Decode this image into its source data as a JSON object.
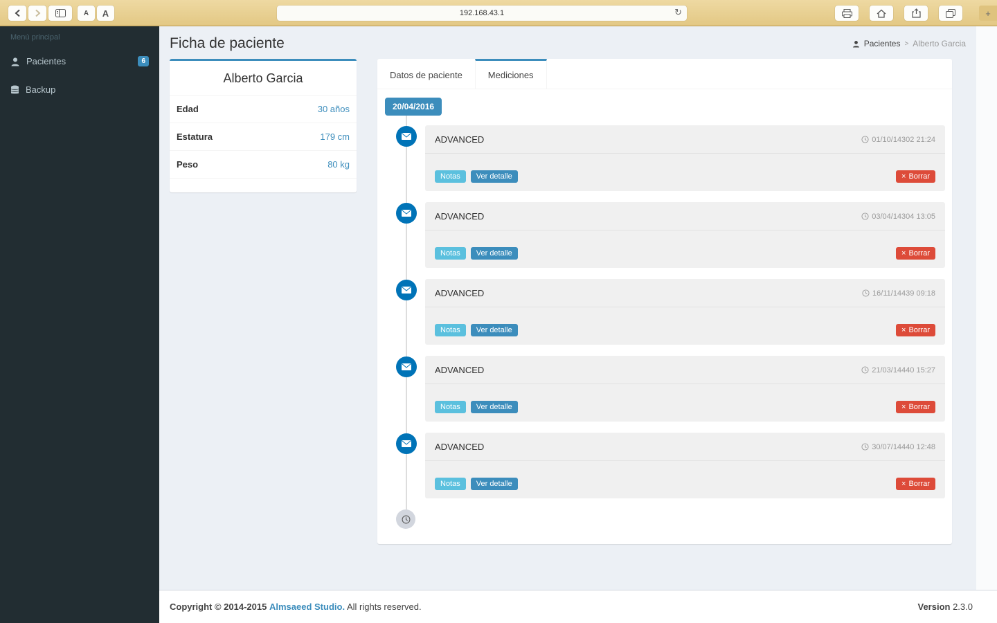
{
  "browser": {
    "url": "192.168.43.1",
    "font_small_label": "A",
    "font_large_label": "A",
    "reload_icon": "↻",
    "new_tab_icon": "+"
  },
  "sidebar": {
    "menu_header": "Menú principal",
    "items": [
      {
        "label": "Pacientes",
        "badge": "6"
      },
      {
        "label": "Backup"
      }
    ]
  },
  "header": {
    "title": "Ficha de paciente",
    "breadcrumb": {
      "root": "Pacientes",
      "separator": ">",
      "current": "Alberto Garcia"
    }
  },
  "patient_card": {
    "name": "Alberto Garcia",
    "rows": [
      {
        "label": "Edad",
        "value": "30 años"
      },
      {
        "label": "Estatura",
        "value": "179 cm"
      },
      {
        "label": "Peso",
        "value": "80 kg"
      }
    ]
  },
  "tabs": {
    "datos": "Datos de paciente",
    "mediciones": "Mediciones"
  },
  "timeline": {
    "date_label": "20/04/2016",
    "entries": [
      {
        "title": "ADVANCED",
        "timestamp": "01/10/14302 21:24"
      },
      {
        "title": "ADVANCED",
        "timestamp": "03/04/14304 13:05"
      },
      {
        "title": "ADVANCED",
        "timestamp": "16/11/14439 09:18"
      },
      {
        "title": "ADVANCED",
        "timestamp": "21/03/14440 15:27"
      },
      {
        "title": "ADVANCED",
        "timestamp": "30/07/14440 12:48"
      }
    ],
    "actions": {
      "notas": "Notas",
      "ver_detalle": "Ver detalle",
      "borrar": "Borrar",
      "borrar_icon": "×"
    }
  },
  "footer": {
    "copyright": "Copyright © 2014-2015",
    "studio_link": "Almsaeed Studio.",
    "rights": "All rights reserved.",
    "version_label": "Version",
    "version_value": "2.3.0"
  },
  "colors": {
    "accent": "#3c8dbc",
    "info_button": "#5bc0de",
    "danger_button": "#dd4b39",
    "timeline_icon_bg": "#0073b7",
    "sidebar_bg": "#222d32",
    "content_bg": "#ecf0f5",
    "chrome_bg": "#e8cf92"
  }
}
